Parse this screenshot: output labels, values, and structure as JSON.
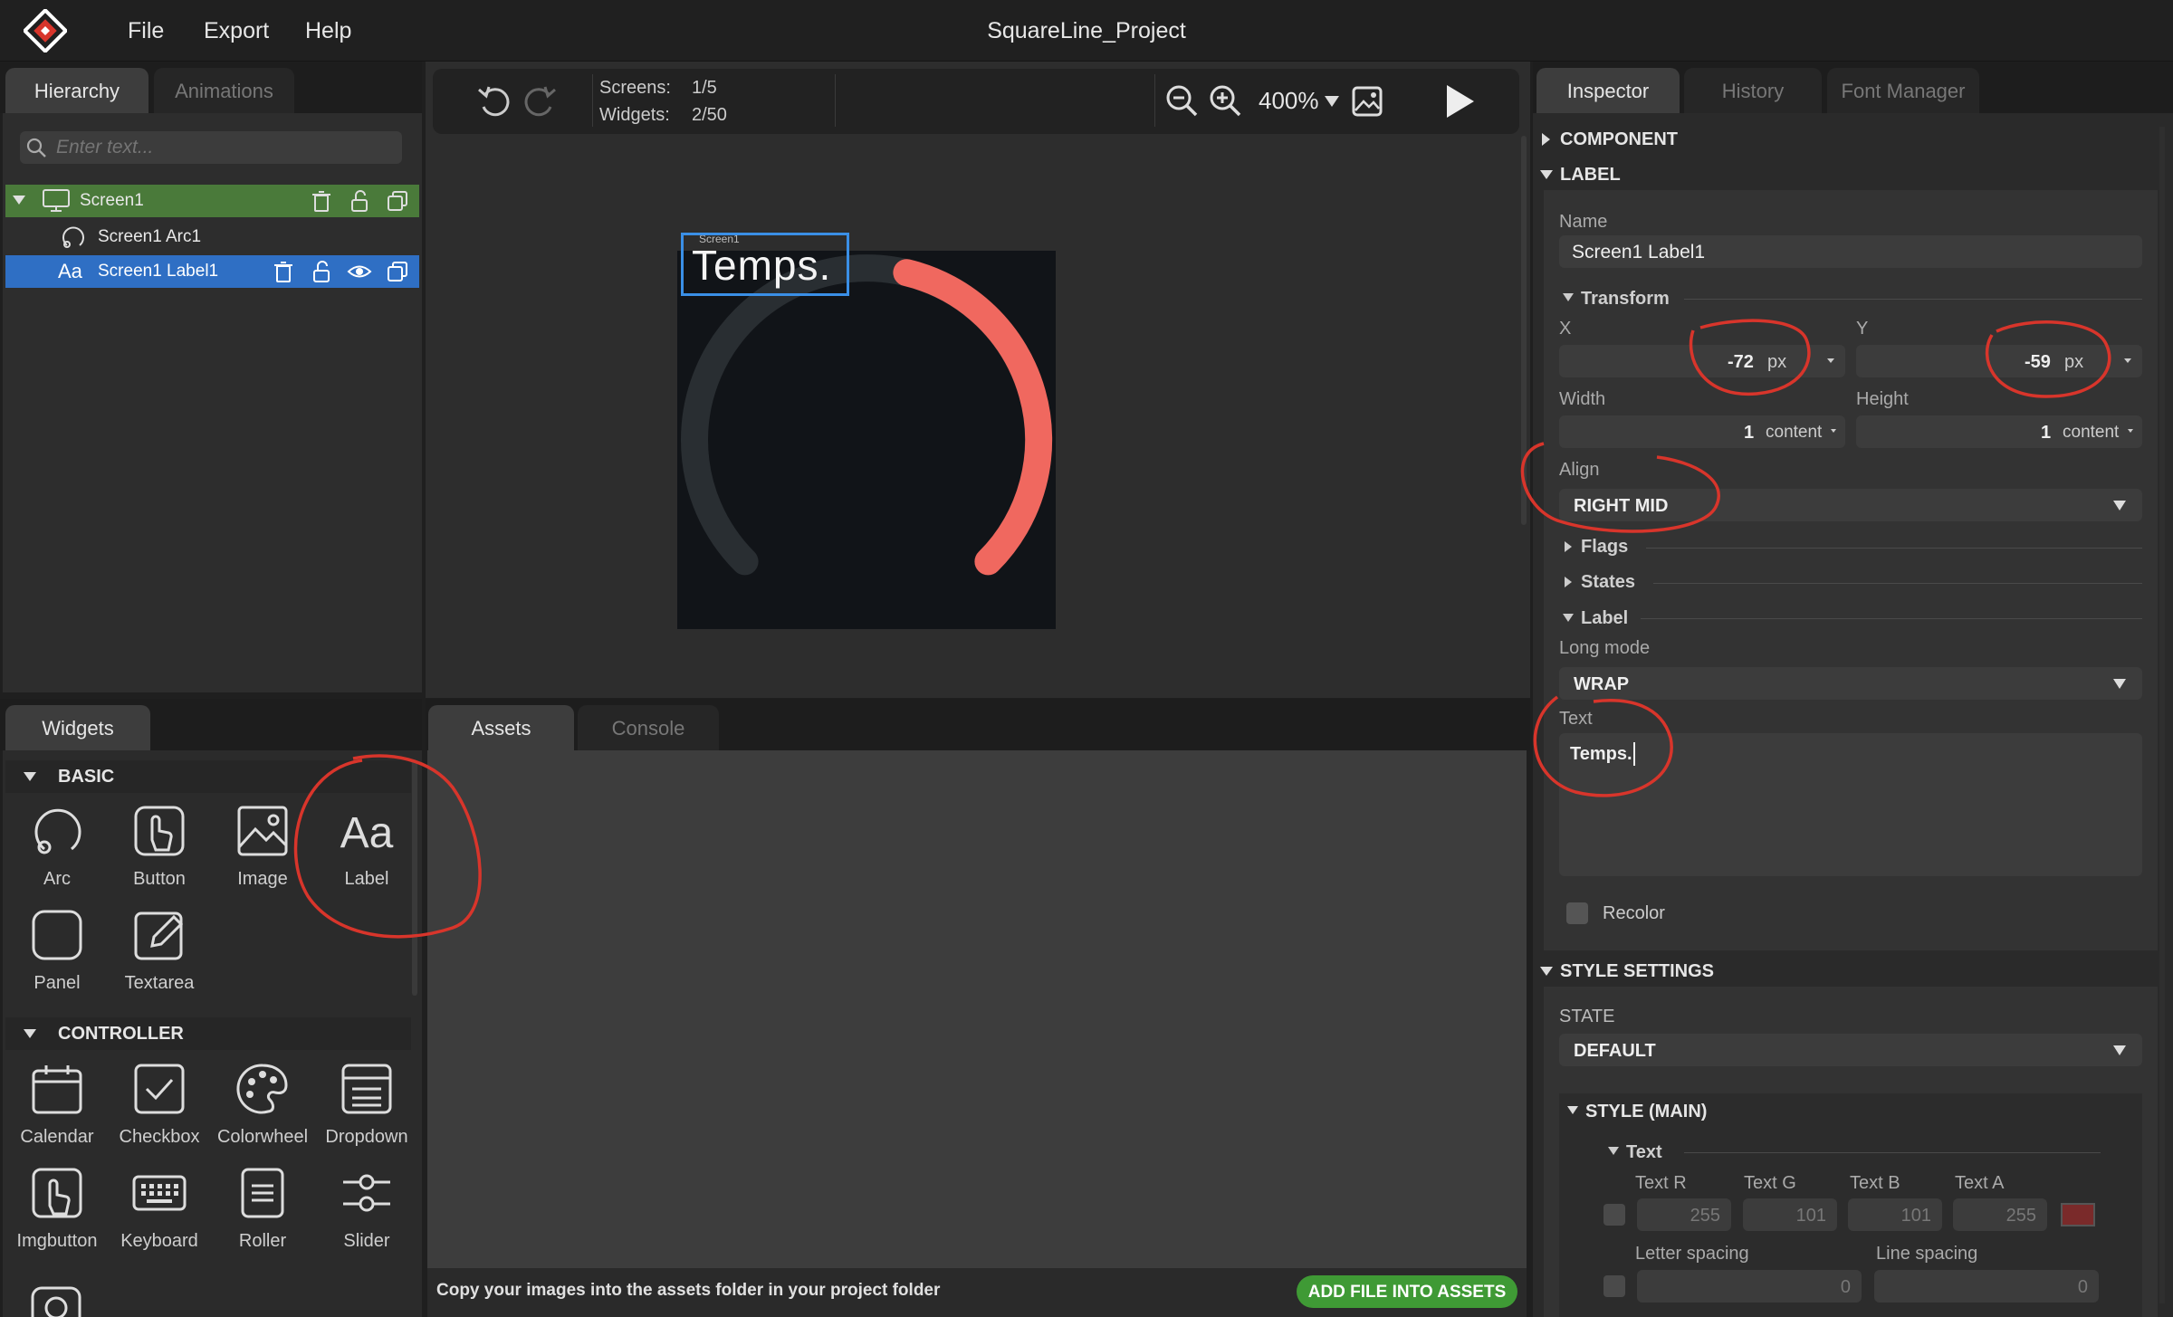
{
  "app": {
    "title": "SquareLine_Project",
    "menu": [
      "File",
      "Export",
      "Help"
    ]
  },
  "hierarchy": {
    "tabs": [
      "Hierarchy",
      "Animations"
    ],
    "search_placeholder": "Enter text...",
    "items": [
      {
        "label": "Screen1"
      },
      {
        "label": "Screen1 Arc1"
      },
      {
        "label": "Screen1 Label1"
      }
    ]
  },
  "toolbar": {
    "screens_label": "Screens:",
    "screens_value": "1/5",
    "widgets_label": "Widgets:",
    "widgets_value": "2/50",
    "zoom": "400%"
  },
  "canvas": {
    "screen_tag": "Screen1",
    "label_text": "Temps.",
    "arc_value_fraction": 0.45,
    "colors": {
      "bg": "#111418",
      "arc_bg": "#292e32",
      "arc_indicator": "#f0685f",
      "selection": "#3a8fe6"
    }
  },
  "widgets": {
    "tab": "Widgets",
    "basic_title": "BASIC",
    "basic": [
      {
        "label": "Arc",
        "icon": "arc-icon"
      },
      {
        "label": "Button",
        "icon": "button-icon"
      },
      {
        "label": "Image",
        "icon": "image-icon"
      },
      {
        "label": "Label",
        "icon": "label-icon"
      },
      {
        "label": "Panel",
        "icon": "panel-icon"
      },
      {
        "label": "Textarea",
        "icon": "textarea-icon"
      }
    ],
    "label_icon_text": "Aa",
    "controller_title": "CONTROLLER",
    "controller": [
      {
        "label": "Calendar",
        "icon": "calendar-icon"
      },
      {
        "label": "Checkbox",
        "icon": "checkbox-icon"
      },
      {
        "label": "Colorwheel",
        "icon": "colorwheel-icon"
      },
      {
        "label": "Dropdown",
        "icon": "dropdown-icon"
      },
      {
        "label": "Imgbutton",
        "icon": "imgbutton-icon"
      },
      {
        "label": "Keyboard",
        "icon": "keyboard-icon"
      },
      {
        "label": "Roller",
        "icon": "roller-icon"
      },
      {
        "label": "Slider",
        "icon": "slider-icon"
      }
    ]
  },
  "assets": {
    "tabs": [
      "Assets",
      "Console"
    ],
    "hint": "Copy your images into the assets folder in your project folder",
    "add_button": "ADD FILE INTO ASSETS"
  },
  "inspector": {
    "tabs": [
      "Inspector",
      "History",
      "Font Manager"
    ],
    "component_section": "COMPONENT",
    "label_section": "LABEL",
    "name_label": "Name",
    "name_value": "Screen1 Label1",
    "transform_title": "Transform",
    "x_label": "X",
    "x_value": "-72",
    "x_unit": "px",
    "y_label": "Y",
    "y_value": "-59",
    "y_unit": "px",
    "width_label": "Width",
    "width_value": "1",
    "width_unit": "content",
    "height_label": "Height",
    "height_value": "1",
    "height_unit": "content",
    "align_label": "Align",
    "align_value": "RIGHT MID",
    "flags_title": "Flags",
    "states_title": "States",
    "label_sub_title": "Label",
    "long_mode_label": "Long mode",
    "long_mode_value": "WRAP",
    "text_label": "Text",
    "text_value": "Temps.",
    "recolor_label": "Recolor",
    "style_settings_title": "STYLE SETTINGS",
    "state_label": "STATE",
    "state_value": "DEFAULT",
    "style_main_title": "STYLE (MAIN)",
    "text_sub_title": "Text",
    "text_r_label": "Text R",
    "text_r_value": "255",
    "text_g_label": "Text G",
    "text_g_value": "101",
    "text_b_label": "Text B",
    "text_b_value": "101",
    "text_a_label": "Text A",
    "text_a_value": "255",
    "swatch_color": "#7a2a2a",
    "letter_spacing_label": "Letter spacing",
    "letter_spacing_value": "0",
    "line_spacing_label": "Line spacing",
    "line_spacing_value": "0"
  },
  "annotation_color": "#d8352b"
}
